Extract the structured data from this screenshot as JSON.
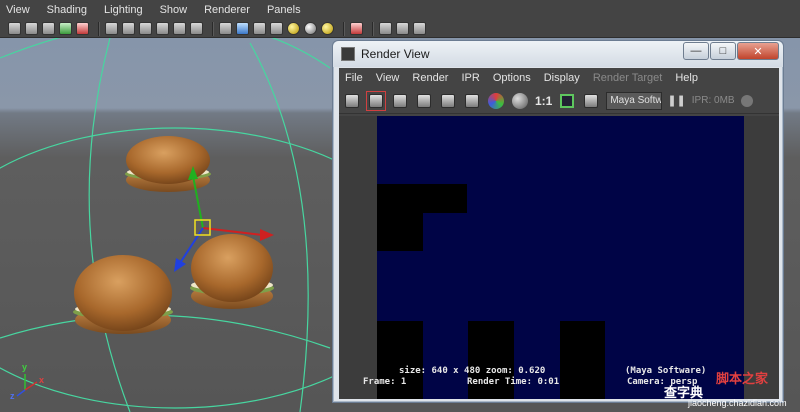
{
  "viewport": {
    "menu": [
      "View",
      "Shading",
      "Lighting",
      "Show",
      "Renderer",
      "Panels"
    ],
    "toolbar_icons": [
      "camera-icon",
      "camera-attr-icon",
      "bookmark-icon",
      "image-plane-icon",
      "grid-icon",
      "wireframe-icon",
      "smooth-shade-icon",
      "smooth-lighting-icon",
      "texture-icon",
      "xray-icon",
      "isolate-icon",
      "cube-icon",
      "cube-blue-icon",
      "cube-outline-icon",
      "checker-icon",
      "yellow-light-icon",
      "grey-sphere-icon",
      "gold-sphere-icon",
      "select-highlight-icon",
      "film-gate-icon",
      "resolution-gate-icon",
      "node-icon"
    ],
    "axis": {
      "y": "y",
      "x": "x",
      "z": "z"
    }
  },
  "render_view": {
    "title": "Render View",
    "window_buttons": {
      "minimize": "—",
      "maximize": "□",
      "close": "✕"
    },
    "menu": [
      {
        "label": "File",
        "enabled": true
      },
      {
        "label": "View",
        "enabled": true
      },
      {
        "label": "Render",
        "enabled": true
      },
      {
        "label": "IPR",
        "enabled": true
      },
      {
        "label": "Options",
        "enabled": true
      },
      {
        "label": "Display",
        "enabled": true
      },
      {
        "label": "Render Target",
        "enabled": false
      },
      {
        "label": "Help",
        "enabled": true
      }
    ],
    "tools": {
      "one_to_one": "1:1",
      "renderer": "Maya Software",
      "ipr_status": "IPR: 0MB"
    },
    "info": {
      "size_line": "size: 640 x 480 zoom: 0.620",
      "renderer_line": "(Maya Software)",
      "frame_line": "Frame: 1",
      "time_line": "Render Time: 0:01",
      "camera_line": "Camera: persp"
    }
  },
  "watermark": {
    "left": "查字典",
    "right": "脚本之家",
    "url": "jiaocheng.chazidian.com"
  },
  "colors": {
    "viewport_bg": "#5e5e5e",
    "render_bg": "#000446",
    "window_frame": "#dfe4ea",
    "manipulator_x": "#d02020",
    "manipulator_y": "#20b020",
    "manipulator_z": "#2040e0"
  }
}
